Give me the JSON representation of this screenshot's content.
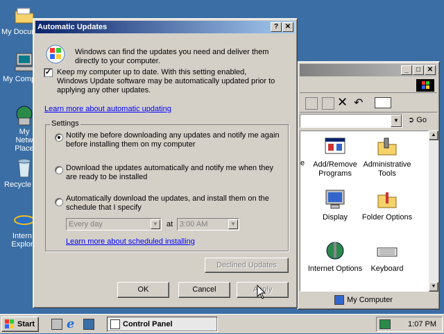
{
  "desktop": {
    "icons": [
      {
        "label": "My Docum",
        "icon": "folder-icon"
      },
      {
        "label": "My Comp",
        "icon": "computer-icon"
      },
      {
        "label": "My Netw Place",
        "icon": "network-icon"
      },
      {
        "label": "Recycle",
        "icon": "recycle-bin-icon"
      },
      {
        "label": "Intern Explor",
        "icon": "ie-icon"
      }
    ]
  },
  "dialog": {
    "title": "Automatic Updates",
    "help_btn": "?",
    "close_btn": "✕",
    "intro": "Windows can find the updates you need and deliver them directly to your computer.",
    "keep_up_to_date": "Keep my computer up to date. With this setting enabled, Windows Update software may be automatically updated prior to applying any other updates.",
    "keep_checked": true,
    "learn_more_auto": "Learn more about automatic updating",
    "settings_label": "Settings",
    "options": [
      {
        "label": "Notify me before downloading any updates and notify me again before installing them on my computer",
        "selected": true
      },
      {
        "label": "Download the updates automatically and notify me when they are ready to be installed",
        "selected": false
      },
      {
        "label": "Automatically download the updates, and install them on the schedule that I specify",
        "selected": false
      }
    ],
    "schedule_day": "Every day",
    "at_label": "at",
    "schedule_time": "3:00 AM",
    "learn_more_schedule": "Learn more about scheduled installing",
    "declined_updates": "Declined Updates",
    "ok": "OK",
    "cancel": "Cancel",
    "apply": "Apply"
  },
  "control_panel": {
    "partial_label": "e",
    "go": "Go",
    "items": [
      {
        "label": "Add/Remove Programs",
        "icon": "add-remove-programs-icon"
      },
      {
        "label": "Administrative Tools",
        "icon": "admin-tools-icon"
      },
      {
        "label": "Display",
        "icon": "display-icon"
      },
      {
        "label": "Folder Options",
        "icon": "folder-options-icon"
      },
      {
        "label": "Internet Options",
        "icon": "internet-options-icon"
      },
      {
        "label": "Keyboard",
        "icon": "keyboard-icon"
      }
    ],
    "status": "My Computer"
  },
  "taskbar": {
    "start": "Start",
    "task": "Control Panel",
    "clock": "1:07 PM"
  }
}
